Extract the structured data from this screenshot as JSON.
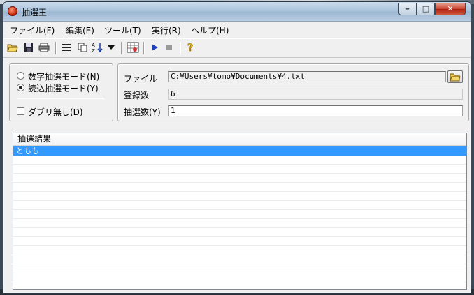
{
  "window": {
    "title": "抽選王"
  },
  "menu": [
    "ファイル(F)",
    "編集(E)",
    "ツール(T)",
    "実行(R)",
    "ヘルプ(H)"
  ],
  "toolbar": {
    "icons": [
      "open-folder-icon",
      "save-icon",
      "print-icon",
      "list-icon",
      "copy-icon",
      "sort-icon",
      "dropdown-arrow-icon",
      "settings-grid-icon",
      "play-icon",
      "stop-icon",
      "help-icon"
    ]
  },
  "mode": {
    "numeric_label": "数字抽選モード(N)",
    "load_label": "読込抽選モード(Y)",
    "selected": "load",
    "no_duplicates_label": "ダブリ無し(D)",
    "no_duplicates_checked": false
  },
  "file": {
    "file_label": "ファイル",
    "file_path": "C:¥Users¥tomo¥Documents¥4.txt",
    "registered_label": "登録数",
    "registered_value": "6",
    "draw_count_label": "抽選数(Y)",
    "draw_count_value": "1"
  },
  "results": {
    "header": "抽選結果",
    "rows": [
      "ともも"
    ]
  },
  "colors": {
    "selection": "#3399ff",
    "close_button": "#c4402c",
    "play": "#1f3fbf"
  }
}
